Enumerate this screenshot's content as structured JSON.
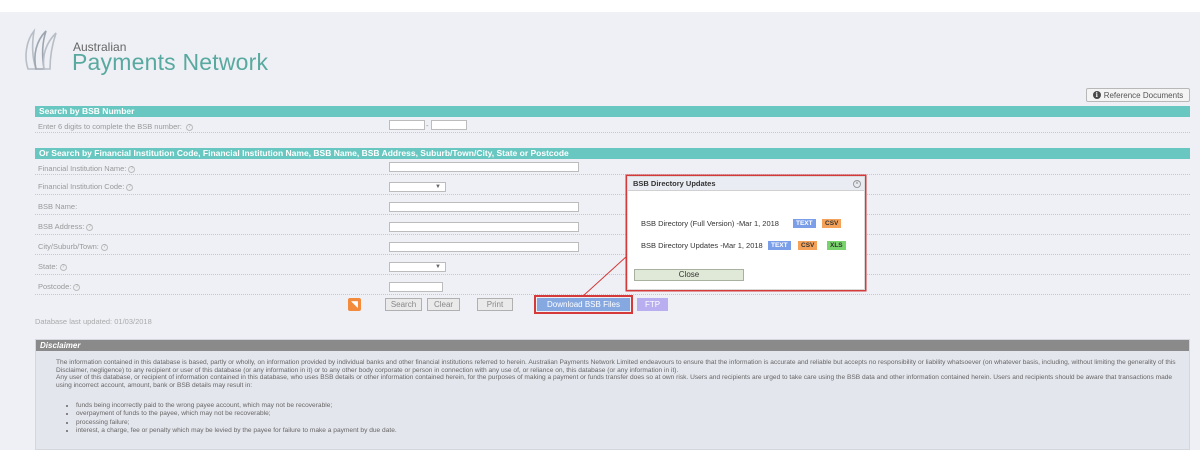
{
  "header": {
    "brand_line1": "Australian",
    "brand_line2": "Payments Network",
    "reference_docs_label": "Reference Documents",
    "brand_color": "#58a99f"
  },
  "bsb_search": {
    "title": "Search by BSB Number",
    "prompt": "Enter 6 digits to complete the BSB number:",
    "separator": "-"
  },
  "fi_search": {
    "title": "Or Search by Financial Institution Code, Financial Institution Name, BSB Name, BSB Address, Suburb/Town/City, State or Postcode",
    "fields": [
      {
        "label": "Financial Institution Name:",
        "type": "text"
      },
      {
        "label": "Financial Institution Code:",
        "type": "select"
      },
      {
        "label": "BSB Name:",
        "type": "text"
      },
      {
        "label": "BSB Address:",
        "type": "text"
      },
      {
        "label": "City/Suburb/Town:",
        "type": "text"
      },
      {
        "label": "State:",
        "type": "select"
      },
      {
        "label": "Postcode:",
        "type": "text"
      }
    ],
    "select_arrow": "▼"
  },
  "actions": {
    "search_label": "Search",
    "clear_label": "Clear",
    "print_label": "Print",
    "download_label": "Download BSB Files",
    "ftp_label": "FTP",
    "rss_glyph": "◥"
  },
  "last_updated": "Database last updated: 01/03/2018",
  "disclaimer": {
    "title": "Disclaimer",
    "paragraph1": "The information contained in this database is based, partly or wholly, on information provided by individual banks and other financial institutions referred to herein. Australian Payments Network Limited endeavours to ensure that the information is accurate and reliable but accepts no responsibility or liability whatsoever (on whatever basis, including, without limiting the generality of this Disclaimer, negligence) to any recipient or user of this database (or any information in it) or to any other body corporate or person in connection with any use of, or reliance on, this database (or any information in it).",
    "paragraph2": "Any user of this database, or recipient of information contained in this database, who uses BSB details or other information contained herein, for the purposes of making a payment or funds transfer does so at own risk.  Users and recipients are urged to take care using the BSB data and other information contained herein. Users and recipients should be aware that transactions made using incorrect account, amount, bank or BSB details may result in:",
    "items": [
      "funds being incorrectly paid to the wrong payee account, which may not be recoverable;",
      "overpayment of funds to the payee, which may not be recoverable;",
      "processing failure;",
      "interest, a charge, fee or penalty which may be levied by the payee for failure to make a payment by due date."
    ]
  },
  "popup": {
    "title": "BSB Directory Updates",
    "row1_label": "BSB Directory (Full Version) -Mar 1, 2018",
    "row2_label": "BSB Directory Updates -Mar 1, 2018",
    "text_tag": "TEXT",
    "csv_tag": "CSV",
    "xls_tag": "XLS",
    "close_label": "Close",
    "close_x": "×"
  },
  "colors": {
    "section_bar": "#68c8c1",
    "highlight": "#d43a3a",
    "download_button": "#86a8e0",
    "ftp_button": "#b9aef0"
  }
}
